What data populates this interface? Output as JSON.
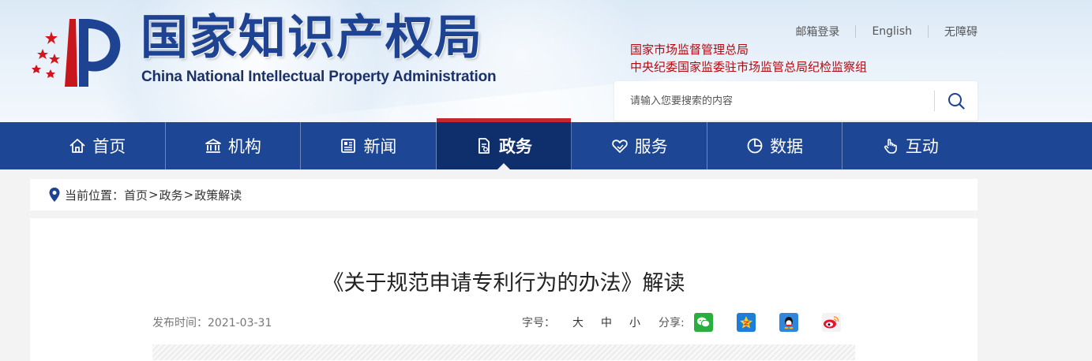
{
  "header": {
    "logo_cn": "国家知识产权局",
    "logo_en": "China National Intellectual Property Administration",
    "top_links": [
      {
        "label": "邮箱登录"
      },
      {
        "label": "English"
      },
      {
        "label": "无障碍"
      }
    ],
    "org_links": [
      "国家市场监督管理总局",
      "中央纪委国家监委驻市场监管总局纪检监察组"
    ],
    "search": {
      "placeholder": "请输入您要搜索的内容",
      "value": ""
    },
    "colors": {
      "brand_blue": "#1d4392",
      "org_red": "#b4090f"
    }
  },
  "nav": {
    "active": "政务",
    "items": [
      {
        "label": "首页",
        "icon": "home-icon"
      },
      {
        "label": "机构",
        "icon": "institution-icon"
      },
      {
        "label": "新闻",
        "icon": "newspaper-icon"
      },
      {
        "label": "政务",
        "icon": "document-icon"
      },
      {
        "label": "服务",
        "icon": "heart-hand-icon"
      },
      {
        "label": "数据",
        "icon": "pie-chart-icon"
      },
      {
        "label": "互动",
        "icon": "pointer-hand-icon"
      }
    ],
    "colors": {
      "bar": "#1d4694",
      "active": "#0f2e6c",
      "active_top": "#c2282d"
    }
  },
  "breadcrumb": {
    "prefix": "当前位置：",
    "items": [
      "首页",
      "政务",
      "政策解读"
    ],
    "separator": ">"
  },
  "article": {
    "title": "《关于规范申请专利行为的办法》解读",
    "publish_label": "发布时间：",
    "publish_date": "2021-03-31",
    "font_size_label": "字号：",
    "font_size_options": [
      "大",
      "中",
      "小"
    ],
    "share_label": "分享:",
    "share_targets": [
      "wechat-icon",
      "qzone-icon",
      "qq-icon",
      "weibo-icon"
    ]
  }
}
